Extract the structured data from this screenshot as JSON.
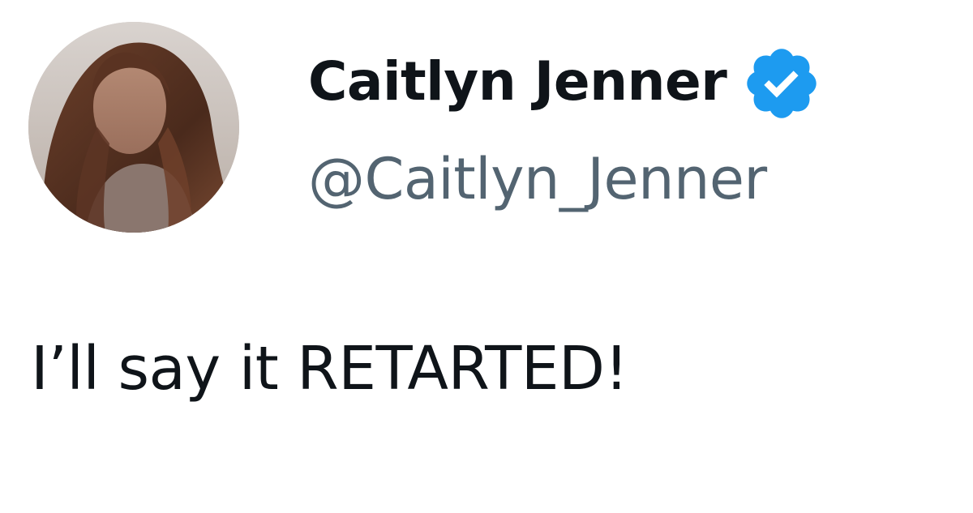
{
  "author": {
    "display_name": "Caitlyn Jenner",
    "handle": "@Caitlyn_Jenner",
    "verified": true,
    "verified_icon": "verified-badge-icon",
    "avatar_icon": "profile-photo"
  },
  "tweet": {
    "text": "I’ll say it RETARTED!"
  },
  "colors": {
    "name": "#0f1419",
    "handle": "#536471",
    "text": "#0f1419",
    "verified_badge": "#1d9bf0",
    "background": "#ffffff"
  }
}
